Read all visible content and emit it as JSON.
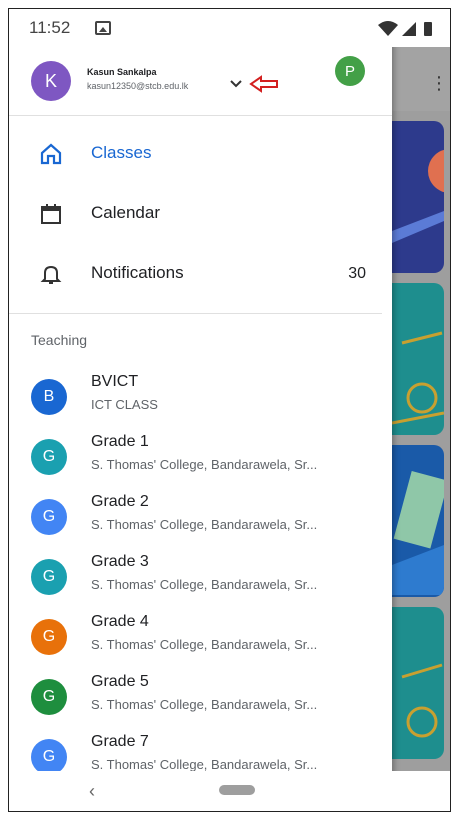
{
  "status_bar": {
    "time": "11:52"
  },
  "account": {
    "initial": "K",
    "avatar_color": "#7e57c2",
    "name": "Kasun Sankalpa",
    "email": "kasun12350@stcb.edu.lk",
    "secondary_initial": "P",
    "secondary_color": "#43a047"
  },
  "nav": {
    "items": [
      {
        "label": "Classes",
        "icon": "home-icon",
        "active": true
      },
      {
        "label": "Calendar",
        "icon": "calendar-icon"
      },
      {
        "label": "Notifications",
        "icon": "bell-icon",
        "count": "30"
      }
    ],
    "active_color": "#1967d2"
  },
  "teaching": {
    "header": "Teaching",
    "classes": [
      {
        "initial": "B",
        "title": "BVICT",
        "subtitle": "ICT CLASS",
        "color": "#1967d2"
      },
      {
        "initial": "G",
        "title": "Grade 1",
        "subtitle": "S. Thomas' College, Bandarawela, Sr...",
        "color": "#1aa0b0"
      },
      {
        "initial": "G",
        "title": "Grade 2",
        "subtitle": "S. Thomas' College, Bandarawela, Sr...",
        "color": "#4285f4"
      },
      {
        "initial": "G",
        "title": "Grade 3",
        "subtitle": "S. Thomas' College, Bandarawela, Sr...",
        "color": "#1aa0b0"
      },
      {
        "initial": "G",
        "title": "Grade 4",
        "subtitle": "S. Thomas' College, Bandarawela, Sr...",
        "color": "#e8710a"
      },
      {
        "initial": "G",
        "title": "Grade 5",
        "subtitle": "S. Thomas' College, Bandarawela, Sr...",
        "color": "#1e8e3e"
      },
      {
        "initial": "G",
        "title": "Grade 7",
        "subtitle": "S. Thomas' College, Bandarawela, Sr...",
        "color": "#4285f4"
      }
    ]
  }
}
